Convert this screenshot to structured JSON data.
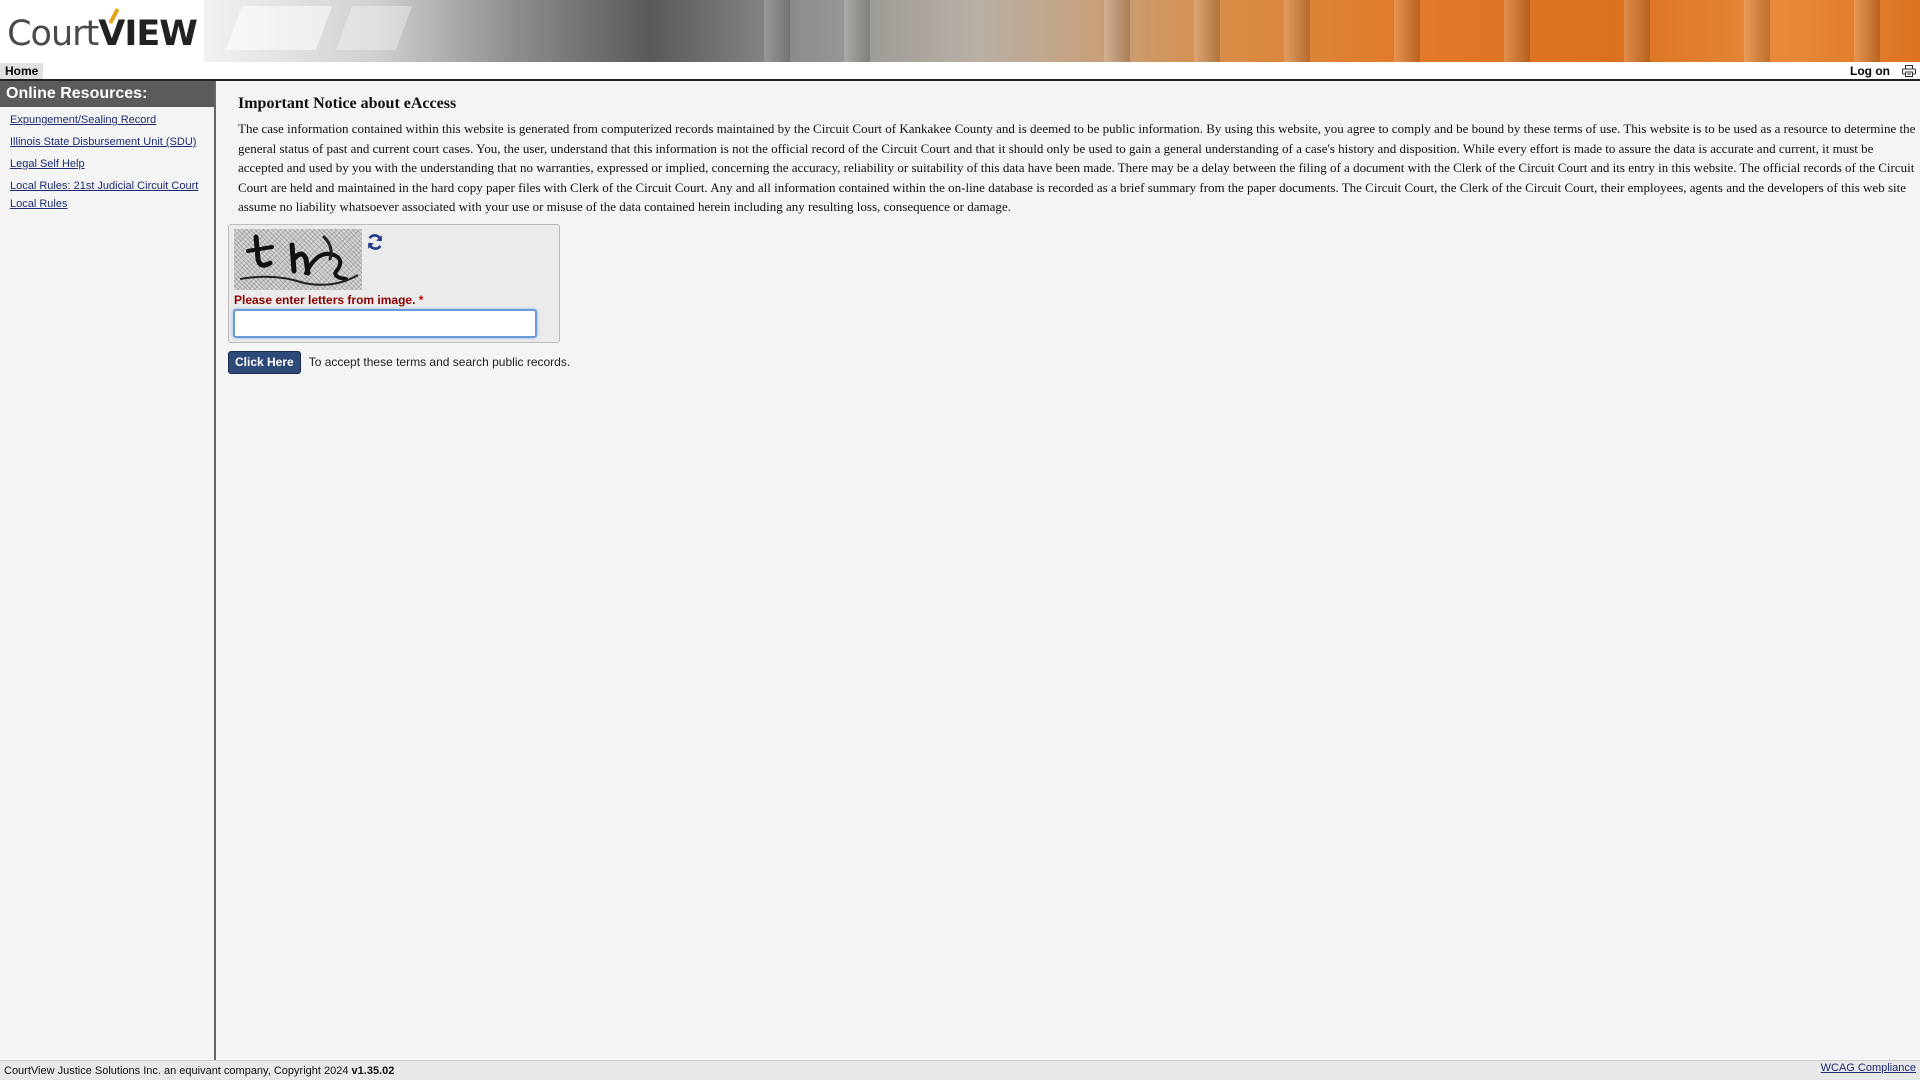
{
  "header": {
    "logo_part1": "Court",
    "logo_part2": "VIEW",
    "logo_accent": "#e8a317"
  },
  "nav": {
    "home": "Home",
    "logon": "Log on",
    "print_icon": "print-icon"
  },
  "sidebar": {
    "title": "Online Resources:",
    "links": [
      {
        "label": "Expungement/Sealing Record"
      },
      {
        "label": "Illinois State Disbursement Unit (SDU)"
      },
      {
        "label": "Legal Self Help"
      },
      {
        "label": "Local Rules: 21st Judicial Circuit Court Local Rules"
      }
    ]
  },
  "notice": {
    "title": "Important Notice about eAccess",
    "body": "The case information contained within this website is generated from computerized records maintained by the Circuit Court of Kankakee County and is deemed to be public information. By using this website, you agree to comply and be bound by these terms of use.  This website is to be used as a resource to determine the general status of past and current court cases. You, the user, understand that this information is not the official record of the Circuit Court and that it should only be used to gain a general understanding of a case's history and disposition. While every effort is made to assure the data is accurate and current, it must be accepted and used by you with the understanding that no warranties, expressed or implied, concerning the accuracy, reliability or suitability of this data have been made.  There may be a delay between the filing of a document with the Clerk of the Circuit Court and its entry in this website. The official records of the Circuit Court are held and maintained in the hard copy paper files with Clerk of the Circuit Court.  Any and all information contained within the on-line database is recorded as a brief summary from the paper documents.  The Circuit Court, the Clerk of the Circuit Court, their employees, agents and the developers of this web site assume no liability whatsoever associated with your use or misuse of the data contained herein including any resulting loss, consequence or damage."
  },
  "captcha": {
    "label": "Please enter letters from image.",
    "required_mark": "*",
    "input_value": "",
    "refresh_icon": "refresh-icon"
  },
  "accept": {
    "button": "Click Here",
    "text": "To accept these terms and search public records."
  },
  "footer": {
    "copyright": "CourtView Justice Solutions Inc. an equivant company, Copyright 2024",
    "version": "v1.35.02",
    "wcag": "WCAG Compliance"
  },
  "colors": {
    "sidebar_header": "#5b5b5b",
    "link": "#1d2c72",
    "button": "#2e4a78",
    "captcha_label": "#8b0000"
  }
}
